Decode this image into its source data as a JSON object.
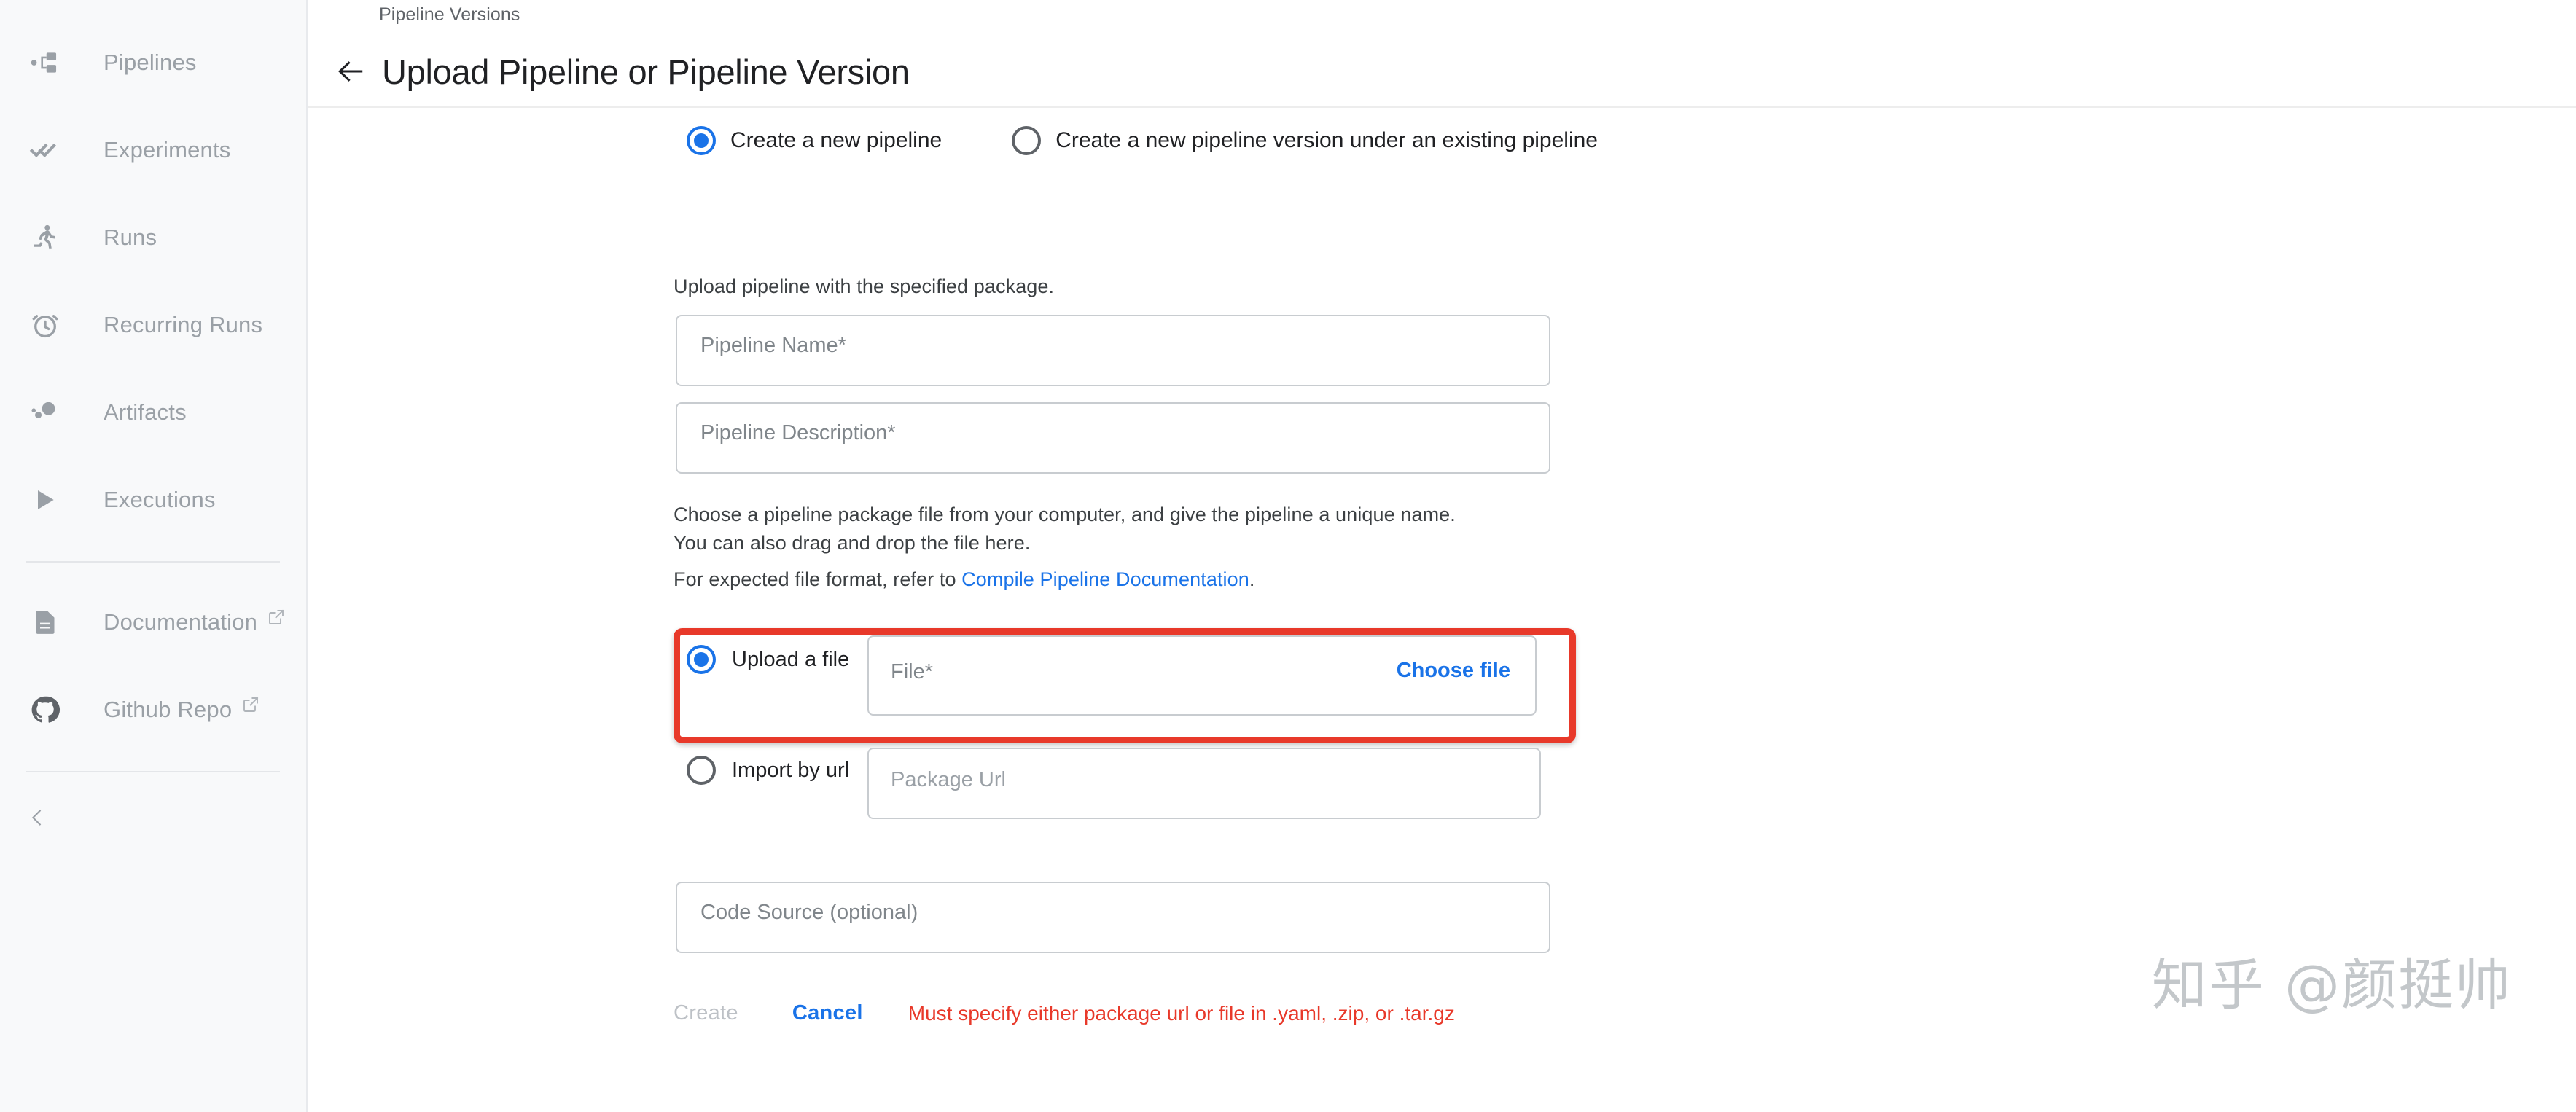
{
  "sidebar": {
    "items": [
      {
        "label": "Pipelines",
        "icon": "pipelines-icon",
        "external": false
      },
      {
        "label": "Experiments",
        "icon": "experiments-icon",
        "external": false
      },
      {
        "label": "Runs",
        "icon": "runs-icon",
        "external": false
      },
      {
        "label": "Recurring Runs",
        "icon": "recurring-runs-icon",
        "external": false
      },
      {
        "label": "Artifacts",
        "icon": "artifacts-icon",
        "external": false
      },
      {
        "label": "Executions",
        "icon": "executions-icon",
        "external": false
      }
    ],
    "links": [
      {
        "label": "Documentation",
        "icon": "document-icon",
        "external": true
      },
      {
        "label": "Github Repo",
        "icon": "github-icon",
        "external": true
      }
    ],
    "collapse_icon": "chevron-left-icon",
    "background_color": "#f8f9fa",
    "text_color": "#9aa0a6"
  },
  "header": {
    "breadcrumb": "Pipeline Versions",
    "back_icon": "arrow-left-icon",
    "title": "Upload Pipeline or Pipeline Version"
  },
  "mode_radios": {
    "options": [
      {
        "label": "Create a new pipeline",
        "selected": true
      },
      {
        "label": "Create a new pipeline version under an existing pipeline",
        "selected": false
      }
    ]
  },
  "helper_text": {
    "upload_note": "Upload pipeline with the specified package.",
    "choose_note": "Choose a pipeline package file from your computer, and give the pipeline a unique name.",
    "drag_note": "You can also drag and drop the file here.",
    "format_prefix": "For expected file format, refer to ",
    "format_link": "Compile Pipeline Documentation",
    "format_suffix": "."
  },
  "fields": {
    "pipeline_name": {
      "placeholder": "Pipeline Name*",
      "value": ""
    },
    "pipeline_description": {
      "placeholder": "Pipeline Description*",
      "value": ""
    },
    "code_source": {
      "placeholder": "Code Source (optional)",
      "value": ""
    }
  },
  "package_source": {
    "upload": {
      "label": "Upload a file",
      "selected": true,
      "file_placeholder": "File*",
      "file_value": "",
      "choose_button": "Choose file"
    },
    "import_url": {
      "label": "Import by url",
      "selected": false,
      "url_placeholder": "Package Url",
      "url_value": ""
    },
    "highlight_color": "#e8392a"
  },
  "actions": {
    "create_label": "Create",
    "create_disabled": true,
    "cancel_label": "Cancel",
    "error_message": "Must specify either package url or file in .yaml, .zip, or .tar.gz",
    "error_color": "#e8392a",
    "accent_color": "#1a73e8"
  },
  "watermark": {
    "text": "知乎 @颜挺帅"
  }
}
